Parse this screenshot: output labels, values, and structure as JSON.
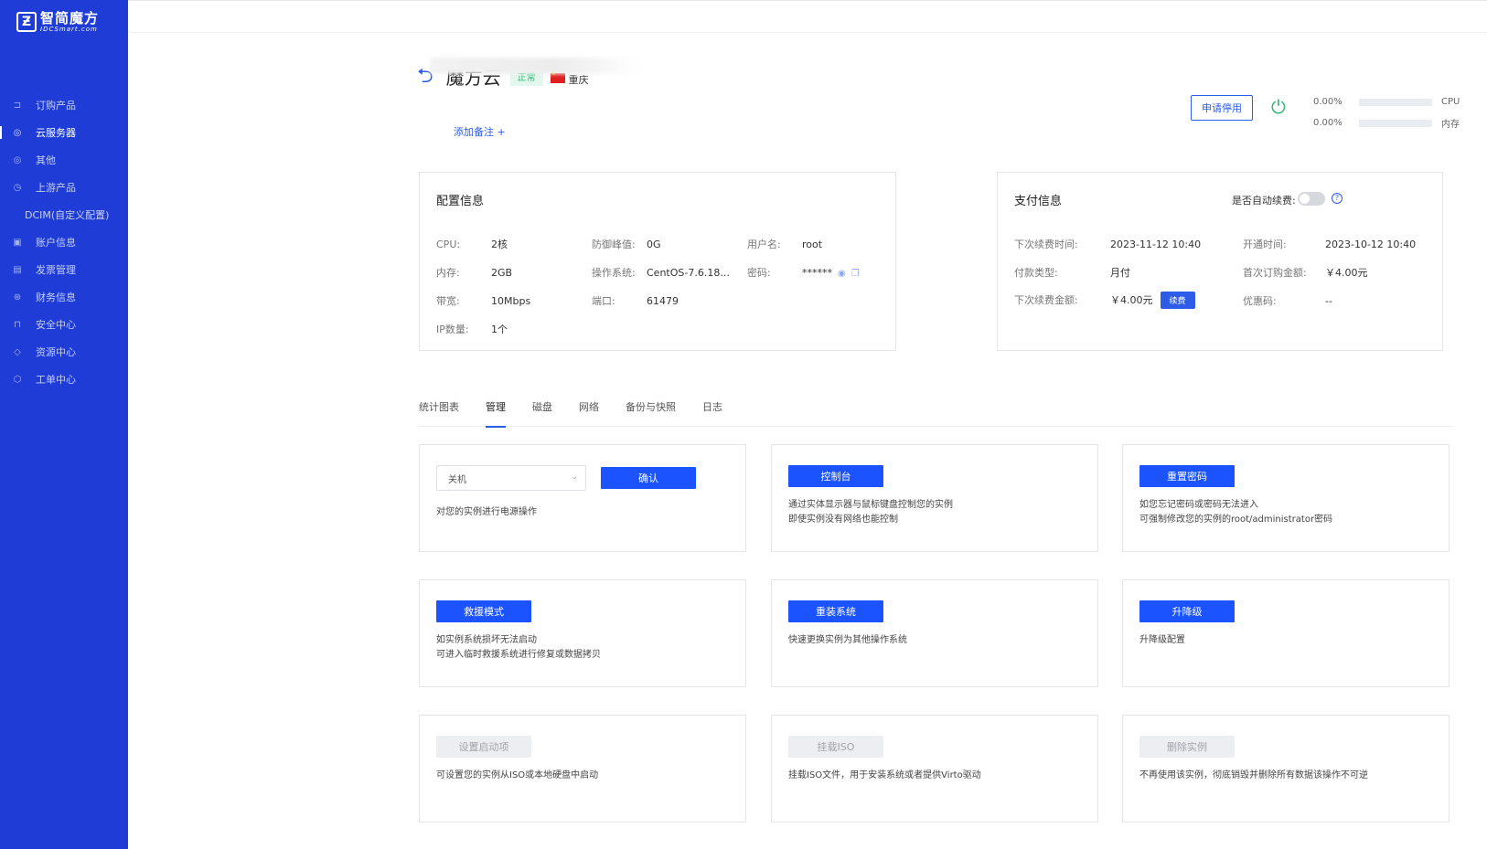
{
  "brand": {
    "logo_mark": "Ƶ",
    "name": "智简魔方",
    "sub": "IDCSmart.com"
  },
  "sidebar": {
    "items": [
      {
        "label": "订购产品",
        "icon": "cart-icon"
      },
      {
        "label": "云服务器",
        "icon": "database-icon"
      },
      {
        "label": "其他",
        "icon": "database-icon"
      },
      {
        "label": "上游产品",
        "icon": "clock-icon"
      },
      {
        "label": "DCIM(自定义配置)",
        "icon": ""
      },
      {
        "label": "账户信息",
        "icon": "user-card-icon"
      },
      {
        "label": "发票管理",
        "icon": "invoice-icon"
      },
      {
        "label": "财务信息",
        "icon": "finance-icon"
      },
      {
        "label": "安全中心",
        "icon": "lock-icon"
      },
      {
        "label": "资源中心",
        "icon": "tag-icon"
      },
      {
        "label": "工单中心",
        "icon": "ticket-icon"
      }
    ]
  },
  "header": {
    "product_name": "魔方云",
    "status": "正常",
    "region": "重庆",
    "add_note": "添加备注 +",
    "stop_button": "申请停用"
  },
  "usage": [
    {
      "value": "0.00%",
      "label": "CPU",
      "percent": 0
    },
    {
      "value": "0.00%",
      "label": "内存",
      "percent": 0
    }
  ],
  "config": {
    "title": "配置信息",
    "rows": [
      {
        "k": "CPU:",
        "v": "2核"
      },
      {
        "k": "内存:",
        "v": "2GB"
      },
      {
        "k": "带宽:",
        "v": "10Mbps"
      },
      {
        "k": "IP数量:",
        "v": "1个"
      },
      {
        "k": "防御峰值:",
        "v": "0G"
      },
      {
        "k": "操作系统:",
        "v": "CentOS-7.6.18..."
      },
      {
        "k": "端口:",
        "v": "61479"
      },
      {
        "k": "用户名:",
        "v": "root"
      },
      {
        "k": "密码:",
        "v": "******"
      }
    ]
  },
  "payment": {
    "title": "支付信息",
    "auto_renew_label": "是否自动续费:",
    "next_renew_time_k": "下次续费时间:",
    "next_renew_time_v": "2023-11-12 10:40",
    "pay_type_k": "付款类型:",
    "pay_type_v": "月付",
    "next_renew_amount_k": "下次续费金额:",
    "next_renew_amount_v": "￥4.00元",
    "renew_button": "续费",
    "open_time_k": "开通时间:",
    "open_time_v": "2023-10-12 10:40",
    "first_amount_k": "首次订购金额:",
    "first_amount_v": "￥4.00元",
    "coupon_k": "优惠码:",
    "coupon_v": "--"
  },
  "tabs": [
    "统计图表",
    "管理",
    "磁盘",
    "网络",
    "备份与快照",
    "日志"
  ],
  "ops": {
    "power": {
      "select_value": "关机",
      "confirm": "确认",
      "desc": "对您的实例进行电源操作"
    },
    "console": {
      "button": "控制台",
      "desc1": "通过实体显示器与鼠标键盘控制您的实例",
      "desc2": "即使实例没有网络也能控制"
    },
    "reset_password": {
      "button": "重置密码",
      "desc1": "如您忘记密码或密码无法进入",
      "desc2": "可强制修改您的实例的root/administrator密码"
    },
    "rescue": {
      "button": "救援模式",
      "desc1": "如实例系统损坏无法启动",
      "desc2": "可进入临时救援系统进行修复或数据拷贝"
    },
    "reinstall": {
      "button": "重装系统",
      "desc1": "快速更换实例为其他操作系统"
    },
    "upgrade": {
      "button": "升降级",
      "desc1": "升降级配置"
    },
    "boot_order": {
      "button": "设置启动项",
      "desc1": "可设置您的实例从ISO或本地硬盘中启动"
    },
    "mount_iso": {
      "button": "挂载ISO",
      "desc1": "挂载ISO文件，用于安装系统或者提供Virto驱动"
    },
    "delete": {
      "button": "删除实例",
      "desc1": "不再使用该实例，彻底销毁并删除所有数据该操作不可逆"
    }
  }
}
